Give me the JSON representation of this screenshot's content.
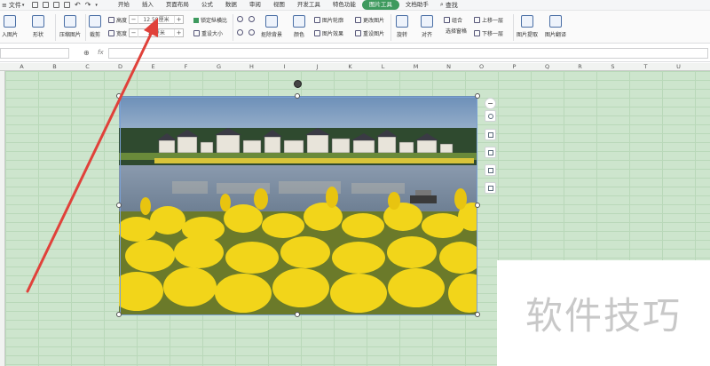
{
  "menubar": {
    "file_label": "文件",
    "tabs": [
      "开始",
      "插入",
      "页面布局",
      "公式",
      "数据",
      "审阅",
      "视图",
      "开发工具",
      "特色功能",
      "图片工具",
      "文档助手"
    ],
    "active_tab": "图片工具",
    "search_label": "查找",
    "accent": "#3e9a5e"
  },
  "ribbon": {
    "insert_picture": "入图片",
    "shape": "形状",
    "compress_picture": "压缩图片",
    "crop": "裁剪",
    "height_label": "高度",
    "height_value": "12.59厘米",
    "width_label": "宽度",
    "width_value": "19厘米",
    "lock_ratio": "锁定纵横比",
    "reset_size": "重设大小",
    "cutout_background": "抠除背景",
    "color": "颜色",
    "picture_outline": "图片轮廓",
    "picture_effect": "图片效果",
    "change_picture": "更改图片",
    "reset_picture": "重设图片",
    "rotate": "旋转",
    "align": "对齐",
    "group": "组合",
    "selection_pane": "选择窗格",
    "bring_forward": "上移一层",
    "send_backward": "下移一层",
    "extract_picture": "图片提取",
    "translate_picture": "图片翻译"
  },
  "formula": {
    "fx": "fx"
  },
  "sheet": {
    "columns": [
      "A",
      "B",
      "C",
      "D",
      "E",
      "F",
      "G",
      "H",
      "I",
      "J",
      "K",
      "L",
      "M",
      "N",
      "O",
      "P",
      "Q",
      "R",
      "S",
      "T",
      "U"
    ],
    "grid_color": "#cde5cd"
  },
  "watermark": {
    "text": "软件技巧"
  },
  "annotation": {
    "arrow_color": "#e0413a"
  }
}
